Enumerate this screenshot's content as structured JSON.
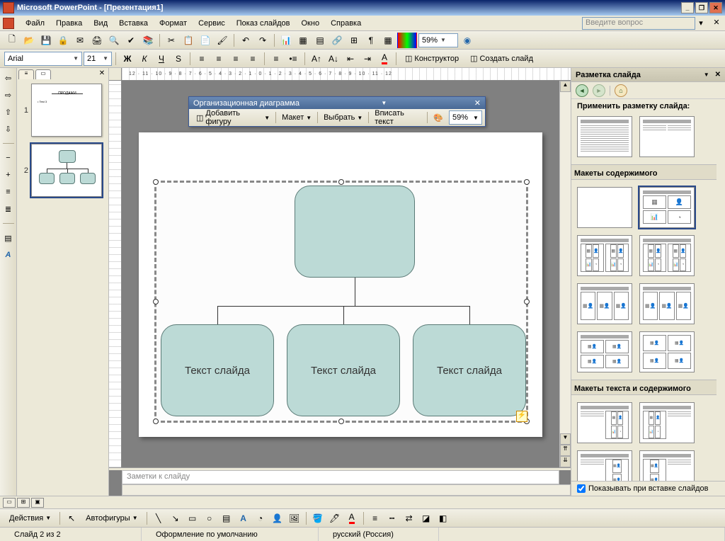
{
  "titlebar": {
    "text": "Microsoft PowerPoint - [Презентация1]"
  },
  "menubar": {
    "items": [
      {
        "u": "Ф",
        "rest": "айл"
      },
      {
        "u": "П",
        "rest": "равка"
      },
      {
        "u": "В",
        "rest": "ид"
      },
      {
        "u": "В",
        "rest": "ст",
        "u2": "а",
        "rest2": "вка"
      },
      {
        "u": "Ф",
        "rest": "ор",
        "u2": "м",
        "rest2": "ат"
      },
      {
        "u": "С",
        "rest": "ервис"
      },
      {
        "u": "П",
        "rest": "ока",
        "u2": "з",
        "rest2": " слайдов"
      },
      {
        "u": "О",
        "rest": "кно"
      },
      {
        "u": "С",
        "rest": "пр",
        "u2": "а",
        "rest2": "вка"
      }
    ],
    "items_text": [
      "Файл",
      "Правка",
      "Вид",
      "Вставка",
      "Формат",
      "Сервис",
      "Показ слайдов",
      "Окно",
      "Справка"
    ],
    "ask_placeholder": "Введите вопрос"
  },
  "toolbar1": {
    "zoom": "59%"
  },
  "toolbar2": {
    "font": "Arial",
    "size": "21",
    "designer": "Конструктор",
    "new_slide": "Создать слайд"
  },
  "thumbs": {
    "slides": [
      "1",
      "2"
    ]
  },
  "orgchart": {
    "title": "Организационная диаграмма",
    "add_shape": "Добавить фигуру",
    "layout": "Макет",
    "select": "Выбрать",
    "fit_text": "Вписать текст",
    "zoom": "59%"
  },
  "diagram": {
    "node1": "",
    "node2": "Текст слайда",
    "node3": "Текст слайда",
    "node4": "Текст слайда"
  },
  "taskpane": {
    "title": "Разметка слайда",
    "apply_label": "Применить разметку слайда:",
    "section_content": "Макеты содержимого",
    "section_text_content": "Макеты текста и содержимого",
    "show_on_insert": "Показывать при вставке слайдов"
  },
  "draw": {
    "actions": "Действия",
    "autoshapes": "Автофигуры"
  },
  "notes": {
    "placeholder": "Заметки к слайду"
  },
  "status": {
    "slide": "Слайд 2 из 2",
    "template": "Оформление по умолчанию",
    "language": "русский (Россия)"
  },
  "ruler_text": "12 · 11 · 10 · 9 · 8 · 7 · 6 · 5 · 4 · 3 · 2 · 1 · 0 · 1 · 2 · 3 · 4 · 5 · 6 · 7 · 8 · 9 · 10 · 11 · 12"
}
